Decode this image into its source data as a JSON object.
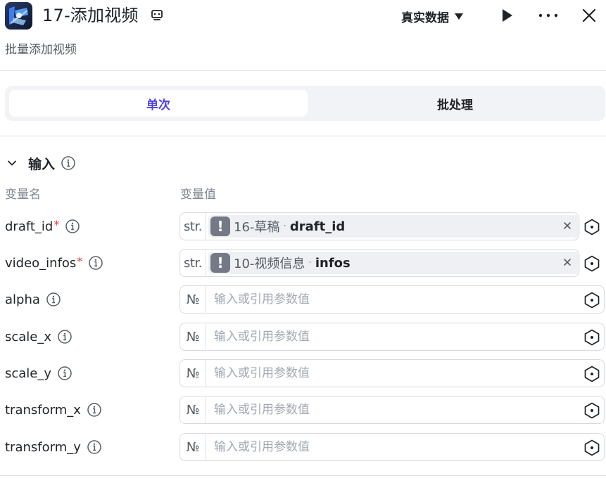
{
  "header": {
    "title": "17-添加视频",
    "mode_label": "真实数据"
  },
  "subtitle": "批量添加视频",
  "tabs": [
    {
      "label": "单次",
      "active": true
    },
    {
      "label": "批处理",
      "active": false
    }
  ],
  "input_section": {
    "label": "输入",
    "col_name": "变量名",
    "col_value": "变量值"
  },
  "params": [
    {
      "name": "draft_id",
      "required": true,
      "type": "str.",
      "ref_node": "16-草稿",
      "ref_var": "draft_id"
    },
    {
      "name": "video_infos",
      "required": true,
      "type": "str.",
      "ref_node": "10-视频信息",
      "ref_var": "infos"
    },
    {
      "name": "alpha",
      "required": false,
      "type": "№",
      "placeholder": "输入或引用参数值"
    },
    {
      "name": "scale_x",
      "required": false,
      "type": "№",
      "placeholder": "输入或引用参数值"
    },
    {
      "name": "scale_y",
      "required": false,
      "type": "№",
      "placeholder": "输入或引用参数值"
    },
    {
      "name": "transform_x",
      "required": false,
      "type": "№",
      "placeholder": "输入或引用参数值"
    },
    {
      "name": "transform_y",
      "required": false,
      "type": "№",
      "placeholder": "输入或引用参数值"
    }
  ],
  "ref_separator": "·",
  "required_mark": "*",
  "warn_glyph": "!",
  "colors": {
    "accent": "#4e40e5",
    "required": "#e23b3b"
  },
  "icons": [
    "app-icon",
    "play-icon",
    "more-icon",
    "close-icon",
    "chevron-down-icon",
    "info-icon",
    "variable-ref-icon",
    "clear-icon"
  ]
}
